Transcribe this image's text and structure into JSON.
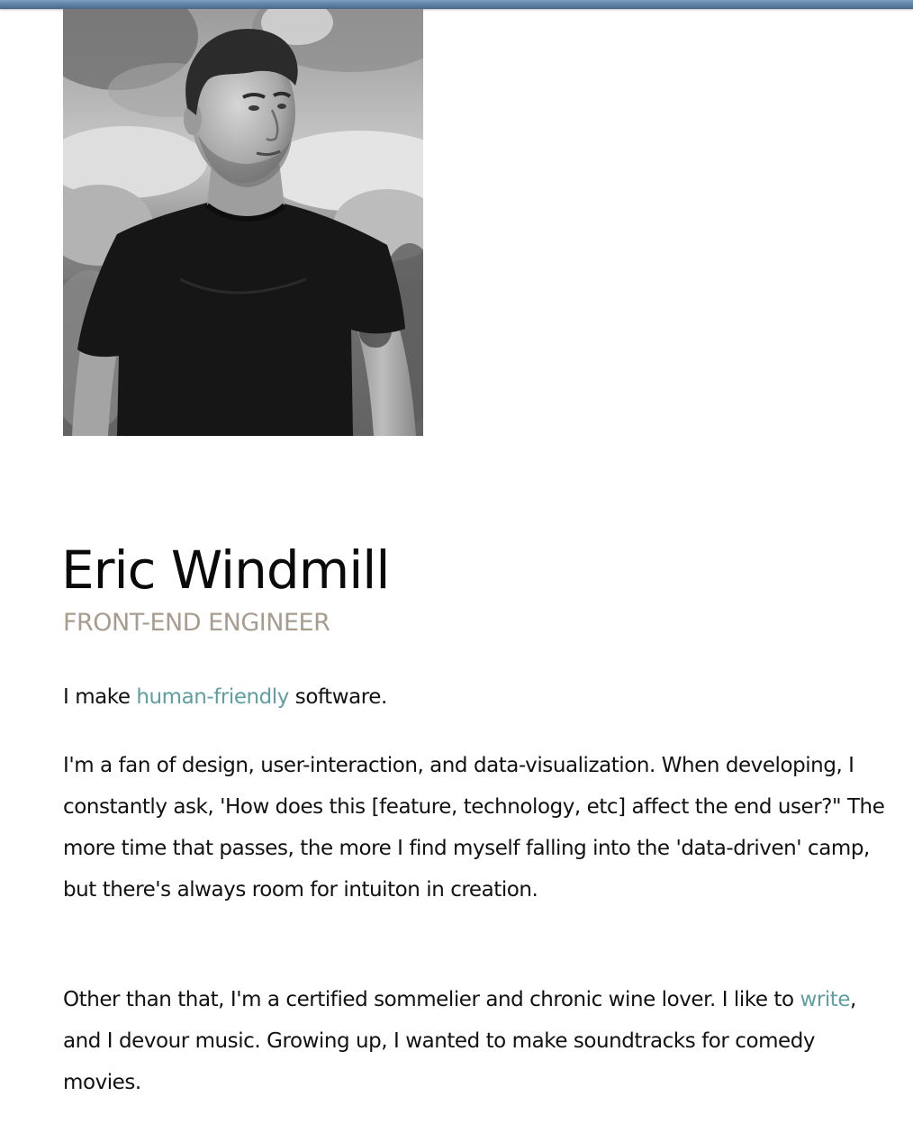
{
  "profile": {
    "name": "Eric Windmill",
    "role": "FRONT-END ENGINEER",
    "photo_alt": "Eric Windmill"
  },
  "bio": {
    "p1": {
      "before": "I make ",
      "link": "human-friendly",
      "after": " software."
    },
    "p2": "I'm a fan of design, user-interaction, and data-visualization. When developing, I constantly ask, 'How does this [feature, technology, etc] affect the end user?\" The more time that passes, the more I find myself falling into the 'data-driven' camp, but there's always room for intuiton in creation.",
    "p3": {
      "before": "Other than that, I'm a certified sommelier and chronic wine lover. I like to ",
      "link": "write",
      "after": ", and I devour music. Growing up, I wanted to make soundtracks for comedy movies."
    }
  },
  "colors": {
    "link": "#5f9ea3",
    "role": "#a89c8e",
    "topbar": "#5d7fa0"
  }
}
